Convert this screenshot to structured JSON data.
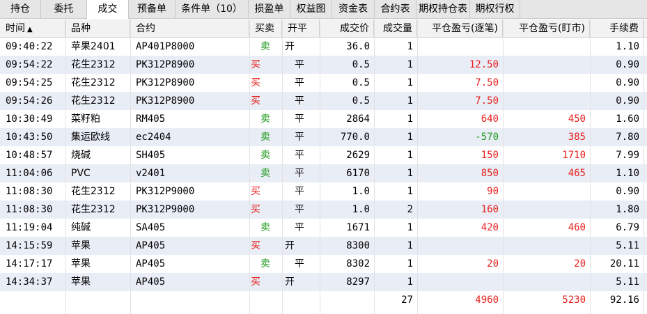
{
  "tabs": [
    {
      "label": "持仓",
      "active": false
    },
    {
      "label": "委托",
      "active": false
    },
    {
      "label": "成交",
      "active": true
    },
    {
      "label": "预备单",
      "active": false
    },
    {
      "label": "条件单（10）",
      "active": false
    },
    {
      "label": "损盈单",
      "active": false
    },
    {
      "label": "权益图",
      "active": false
    },
    {
      "label": "资金表",
      "active": false
    },
    {
      "label": "合约表",
      "active": false
    },
    {
      "label": "期权持仓表",
      "active": false
    },
    {
      "label": "期权行权",
      "active": false
    }
  ],
  "columns": {
    "time": "时间",
    "sort_arrow": "▲",
    "product": "品种",
    "contract": "合约",
    "direction": "买卖",
    "offset": "开平",
    "price": "成交价",
    "volume": "成交量",
    "pnl_trade": "平仓盈亏(逐笔)",
    "pnl_mark": "平仓盈亏(盯市)",
    "fee": "手续费"
  },
  "colors": {
    "buy": "#e8201c",
    "sell": "#1e9a1e",
    "stripe": "#e9edf6"
  },
  "rows": [
    {
      "time": "09:40:22",
      "product": "苹果2401",
      "contract": "AP401P8000",
      "direction": "卖",
      "offset": "开",
      "price": "36.0",
      "volume": "1",
      "pnl_trade": "",
      "pnl_mark": "",
      "fee": "1.10"
    },
    {
      "time": "09:54:22",
      "product": "花生2312",
      "contract": "PK312P8900",
      "direction": "买",
      "offset": "平",
      "price": "0.5",
      "volume": "1",
      "pnl_trade": "12.50",
      "pnl_mark": "",
      "fee": "0.90"
    },
    {
      "time": "09:54:25",
      "product": "花生2312",
      "contract": "PK312P8900",
      "direction": "买",
      "offset": "平",
      "price": "0.5",
      "volume": "1",
      "pnl_trade": "7.50",
      "pnl_mark": "",
      "fee": "0.90"
    },
    {
      "time": "09:54:26",
      "product": "花生2312",
      "contract": "PK312P8900",
      "direction": "买",
      "offset": "平",
      "price": "0.5",
      "volume": "1",
      "pnl_trade": "7.50",
      "pnl_mark": "",
      "fee": "0.90"
    },
    {
      "time": "10:30:49",
      "product": "菜籽粕",
      "contract": "RM405",
      "direction": "卖",
      "offset": "平",
      "price": "2864",
      "volume": "1",
      "pnl_trade": "640",
      "pnl_mark": "450",
      "fee": "1.60"
    },
    {
      "time": "10:43:50",
      "product": "集运欧线",
      "contract": "ec2404",
      "direction": "卖",
      "offset": "平",
      "price": "770.0",
      "volume": "1",
      "pnl_trade": "-570",
      "pnl_mark": "385",
      "fee": "7.80"
    },
    {
      "time": "10:48:57",
      "product": "烧碱",
      "contract": "SH405",
      "direction": "卖",
      "offset": "平",
      "price": "2629",
      "volume": "1",
      "pnl_trade": "150",
      "pnl_mark": "1710",
      "fee": "7.99"
    },
    {
      "time": "11:04:06",
      "product": "PVC",
      "contract": "v2401",
      "direction": "卖",
      "offset": "平",
      "price": "6170",
      "volume": "1",
      "pnl_trade": "850",
      "pnl_mark": "465",
      "fee": "1.10"
    },
    {
      "time": "11:08:30",
      "product": "花生2312",
      "contract": "PK312P9000",
      "direction": "买",
      "offset": "平",
      "price": "1.0",
      "volume": "1",
      "pnl_trade": "90",
      "pnl_mark": "",
      "fee": "0.90"
    },
    {
      "time": "11:08:30",
      "product": "花生2312",
      "contract": "PK312P9000",
      "direction": "买",
      "offset": "平",
      "price": "1.0",
      "volume": "2",
      "pnl_trade": "160",
      "pnl_mark": "",
      "fee": "1.80"
    },
    {
      "time": "11:19:04",
      "product": "纯碱",
      "contract": "SA405",
      "direction": "卖",
      "offset": "平",
      "price": "1671",
      "volume": "1",
      "pnl_trade": "420",
      "pnl_mark": "460",
      "fee": "6.79"
    },
    {
      "time": "14:15:59",
      "product": "苹果",
      "contract": "AP405",
      "direction": "买",
      "offset": "开",
      "price": "8300",
      "volume": "1",
      "pnl_trade": "",
      "pnl_mark": "",
      "fee": "5.11"
    },
    {
      "time": "14:17:17",
      "product": "苹果",
      "contract": "AP405",
      "direction": "卖",
      "offset": "平",
      "price": "8302",
      "volume": "1",
      "pnl_trade": "20",
      "pnl_mark": "20",
      "fee": "20.11"
    },
    {
      "time": "14:34:37",
      "product": "苹果",
      "contract": "AP405",
      "direction": "买",
      "offset": "开",
      "price": "8297",
      "volume": "1",
      "pnl_trade": "",
      "pnl_mark": "",
      "fee": "5.11"
    }
  ],
  "totals": {
    "volume": "27",
    "pnl_trade": "4960",
    "pnl_mark": "5230",
    "fee": "92.16"
  }
}
